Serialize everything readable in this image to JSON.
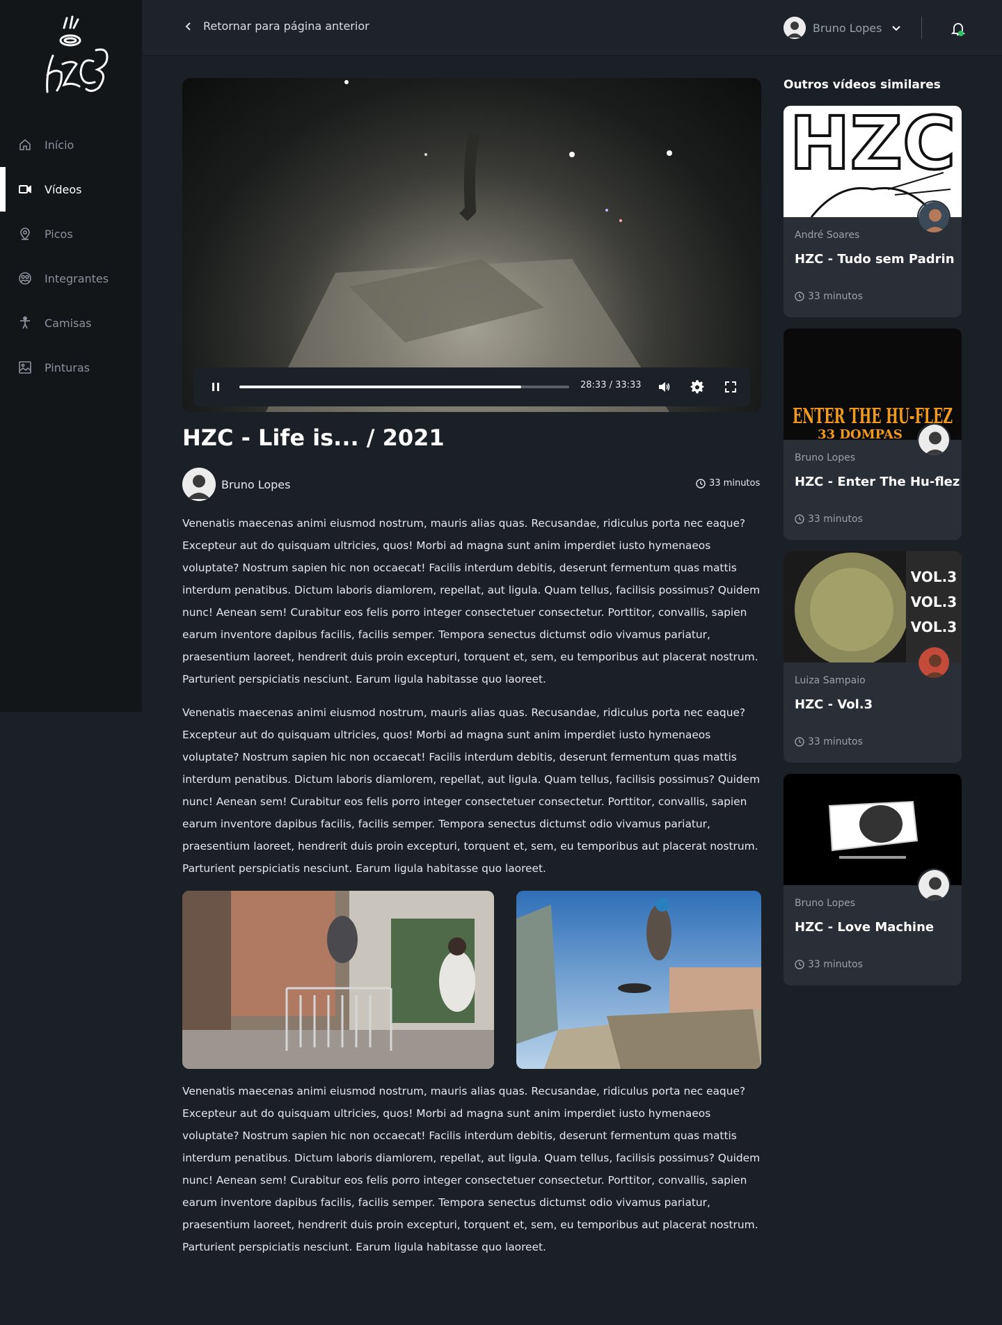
{
  "brand": {
    "logo_text": "hzc"
  },
  "sidebar": {
    "items": [
      {
        "label": "Início",
        "icon": "home-icon"
      },
      {
        "label": "Vídeos",
        "icon": "video-camera-icon",
        "active": true
      },
      {
        "label": "Picos",
        "icon": "map-pin-icon"
      },
      {
        "label": "Integrantes",
        "icon": "group-icon"
      },
      {
        "label": "Camisas",
        "icon": "person-icon"
      },
      {
        "label": "Pinturas",
        "icon": "image-icon"
      }
    ]
  },
  "header": {
    "back_label": "Retornar para página anterior",
    "user_name": "Bruno Lopes",
    "notification_dot_color": "#2fc363"
  },
  "player": {
    "time": "28:33 / 33:33",
    "progress": 0.855
  },
  "video": {
    "title": "HZC - Life is... / 2021",
    "author": "Bruno Lopes",
    "duration": "33 minutos",
    "paragraphs": [
      "Venenatis maecenas animi eiusmod nostrum, mauris alias quas. Recusandae, ridiculus porta nec eaque? Excepteur aut do quisquam ultricies, quos! Morbi ad magna sunt anim imperdiet iusto hymenaeos voluptate? Nostrum sapien hic non occaecat! Facilis interdum debitis, deserunt fermentum quas mattis interdum penatibus. Dictum laboris diamlorem, repellat, aut ligula. Quam tellus, facilisis possimus? Quidem nunc! Aenean sem! Curabitur eos felis porro integer consectetuer consectetur. Porttitor, convallis, sapien earum inventore dapibus facilis, facilis semper. Tempora senectus dictumst odio vivamus pariatur, praesentium laoreet, hendrerit duis proin excepturi, torquent et, sem, eu temporibus aut placerat nostrum. Parturient perspiciatis nesciunt. Earum ligula habitasse quo laoreet.",
      "Venenatis maecenas animi eiusmod nostrum, mauris alias quas. Recusandae, ridiculus porta nec eaque? Excepteur aut do quisquam ultricies, quos! Morbi ad magna sunt anim imperdiet iusto hymenaeos voluptate? Nostrum sapien hic non occaecat! Facilis interdum debitis, deserunt fermentum quas mattis interdum penatibus. Dictum laboris diamlorem, repellat, aut ligula. Quam tellus, facilisis possimus? Quidem nunc! Aenean sem! Curabitur eos felis porro integer consectetuer consectetur. Porttitor, convallis, sapien earum inventore dapibus facilis, facilis semper. Tempora senectus dictumst odio vivamus pariatur, praesentium laoreet, hendrerit duis proin excepturi, torquent et, sem, eu temporibus aut placerat nostrum. Parturient perspiciatis nesciunt. Earum ligula habitasse quo laoreet.",
      "Venenatis maecenas animi eiusmod nostrum, mauris alias quas. Recusandae, ridiculus porta nec eaque? Excepteur aut do quisquam ultricies, quos! Morbi ad magna sunt anim imperdiet iusto hymenaeos voluptate? Nostrum sapien hic non occaecat! Facilis interdum debitis, deserunt fermentum quas mattis interdum penatibus. Dictum laboris diamlorem, repellat, aut ligula. Quam tellus, facilisis possimus? Quidem nunc! Aenean sem! Curabitur eos felis porro integer consectetuer consectetur. Porttitor, convallis, sapien earum inventore dapibus facilis, facilis semper. Tempora senectus dictumst odio vivamus pariatur, praesentium laoreet, hendrerit duis proin excepturi, torquent et, sem, eu temporibus aut placerat nostrum. Parturient perspiciatis nesciunt. Earum ligula habitasse quo laoreet."
    ]
  },
  "similar": {
    "title": "Outros vídeos similares",
    "videos": [
      {
        "author": "André Soares",
        "title": "HZC - Tudo sem Padrin",
        "duration": "33 minutos",
        "thumb_text": "HZC"
      },
      {
        "author": "Bruno Lopes",
        "title": "HZC - Enter The Hu-flez",
        "duration": "33 minutos",
        "thumb_text": "ENTER THE HU-FLEZ",
        "thumb_subtext": "33 DOMPAS"
      },
      {
        "author": "Luiza Sampaio",
        "title": "HZC - Vol.3",
        "duration": "33 minutos",
        "thumb_text": "VOL.3"
      },
      {
        "author": "Bruno Lopes",
        "title": "HZC - Love Machine",
        "duration": "33 minutos"
      }
    ]
  }
}
